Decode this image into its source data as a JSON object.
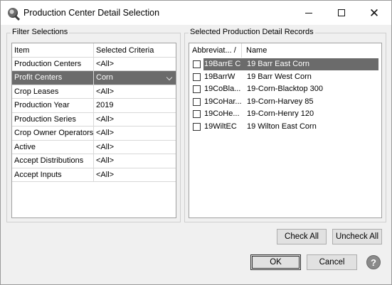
{
  "window": {
    "title": "Production Center Detail Selection",
    "icon": "magnifier-app-icon"
  },
  "filter": {
    "group_label": "Filter Selections",
    "headers": {
      "item": "Item",
      "criteria": "Selected Criteria"
    },
    "rows": [
      {
        "item": "Production Centers",
        "criteria": "<All>"
      },
      {
        "item": "Profit Centers",
        "criteria": "Corn",
        "selected": true
      },
      {
        "item": "Crop Leases",
        "criteria": "<All>"
      },
      {
        "item": "Production Year",
        "criteria": "2019"
      },
      {
        "item": "Production Series",
        "criteria": "<All>"
      },
      {
        "item": "Crop Owner Operators",
        "criteria": "<All>"
      },
      {
        "item": "Active",
        "criteria": "<All>"
      },
      {
        "item": "Accept Distributions",
        "criteria": "<All>"
      },
      {
        "item": "Accept Inputs",
        "criteria": "<All>"
      }
    ]
  },
  "records": {
    "group_label": "Selected Production Detail Records",
    "headers": {
      "abbreviation": "Abbreviat... /",
      "name": "Name"
    },
    "rows": [
      {
        "abbr": "19BarrE C",
        "name": "19 Barr East Corn",
        "checked": false,
        "selected": true
      },
      {
        "abbr": "19BarrW",
        "name": "19 Barr West Corn",
        "checked": false
      },
      {
        "abbr": "19CoBla...",
        "name": "19-Corn-Blacktop 300",
        "checked": false
      },
      {
        "abbr": "19CoHar...",
        "name": "19-Corn-Harvey 85",
        "checked": false
      },
      {
        "abbr": "19CoHe...",
        "name": "19-Corn-Henry 120",
        "checked": false
      },
      {
        "abbr": "19WiltEC",
        "name": "19 Wilton East Corn",
        "checked": false
      }
    ]
  },
  "buttons": {
    "check_all": "Check All",
    "uncheck_all": "Uncheck All",
    "ok": "OK",
    "cancel": "Cancel",
    "help": "?"
  },
  "colors": {
    "selection": "#6b6b6b",
    "dialog_bg": "#f0f0f0"
  }
}
